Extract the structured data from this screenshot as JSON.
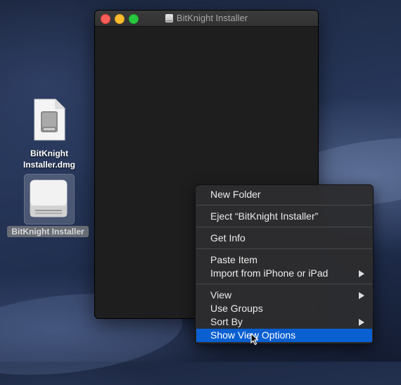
{
  "window": {
    "title": "BitKnight Installer",
    "title_icon": "disk-icon"
  },
  "desktop": {
    "items": [
      {
        "label": "BitKnight Installer.dmg",
        "label_line1": "BitKnight",
        "label_line2": "Installer.dmg",
        "icon": "dmg-file-icon",
        "selected": false
      },
      {
        "label": "BitKnight Installer",
        "icon": "mounted-disk-icon",
        "selected": true
      }
    ]
  },
  "context_menu": {
    "items": [
      {
        "label": "New Folder",
        "submenu": false
      },
      {
        "label": "Eject “BitKnight Installer”",
        "submenu": false
      },
      {
        "label": "Get Info",
        "submenu": false
      },
      {
        "label": "Paste Item",
        "submenu": false
      },
      {
        "label": "Import from iPhone or iPad",
        "submenu": true
      },
      {
        "label": "View",
        "submenu": true
      },
      {
        "label": "Use Groups",
        "submenu": false
      },
      {
        "label": "Sort By",
        "submenu": true
      },
      {
        "label": "Show View Options",
        "submenu": false,
        "highlighted": true
      }
    ]
  },
  "colors": {
    "highlight": "#0a5fd1",
    "close": "#fd5f57",
    "minimize": "#febc2e",
    "maximize": "#28c840"
  }
}
